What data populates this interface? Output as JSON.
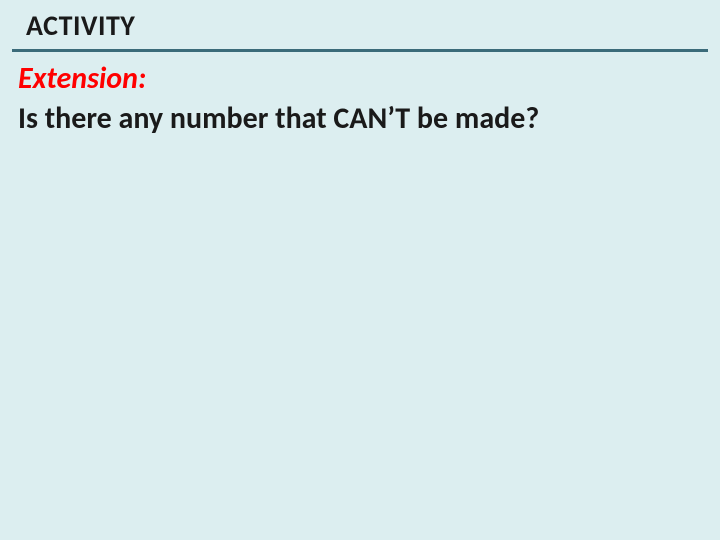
{
  "header": {
    "title": "ACTIVITY"
  },
  "content": {
    "extension_label": "Extension:",
    "question": "Is there any number that CAN’T be made?"
  }
}
